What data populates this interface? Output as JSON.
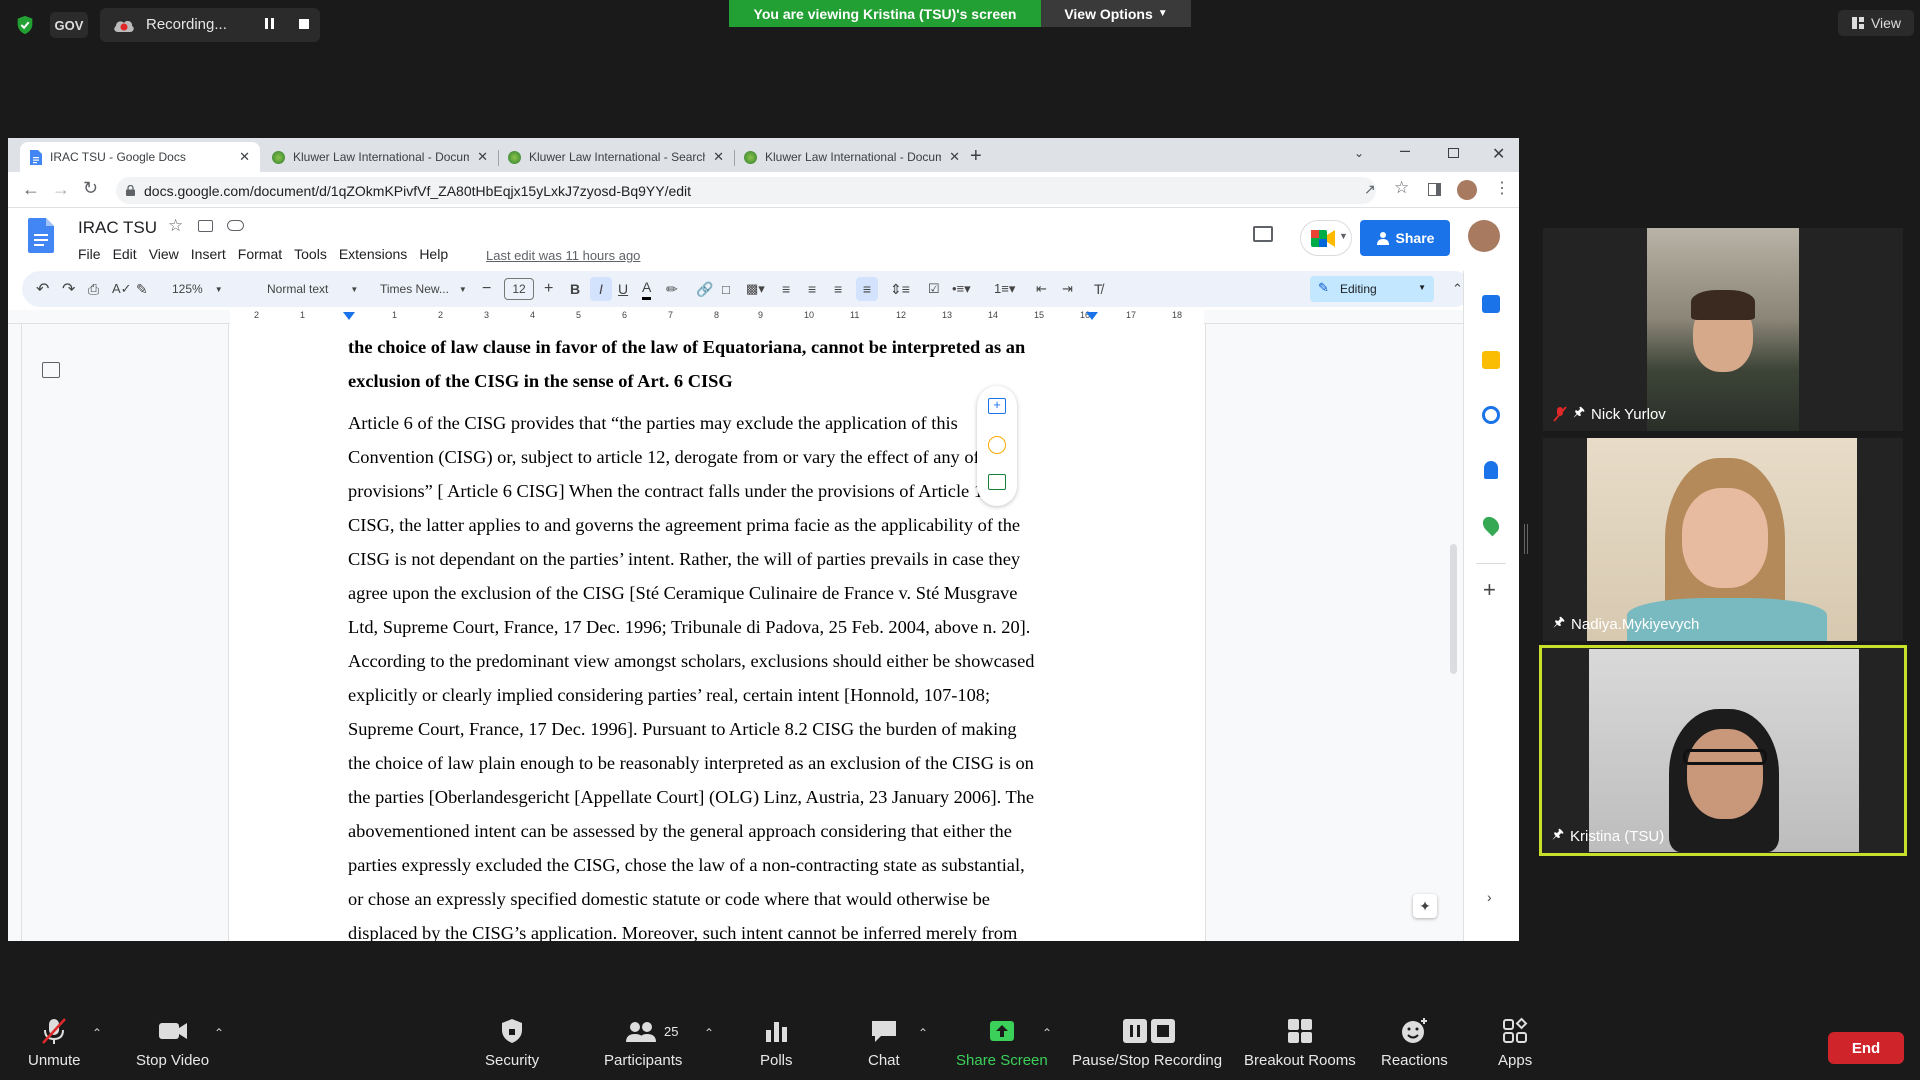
{
  "zoom": {
    "gov_label": "GOV",
    "recording_label": "Recording...",
    "viewing_banner": "You are viewing Kristina (TSU)'s screen",
    "view_options": "View Options",
    "view_label": "View",
    "bottom": {
      "unmute": "Unmute",
      "stop_video": "Stop Video",
      "security": "Security",
      "participants": "Participants",
      "participants_count": "25",
      "polls": "Polls",
      "chat": "Chat",
      "share_screen": "Share Screen",
      "pause_stop_recording": "Pause/Stop Recording",
      "breakout_rooms": "Breakout Rooms",
      "reactions": "Reactions",
      "apps": "Apps",
      "end": "End"
    },
    "participants": [
      {
        "name": "Nick Yurlov"
      },
      {
        "name": "Nadiya.Mykiyevych"
      },
      {
        "name": "Kristina (TSU)"
      }
    ]
  },
  "browser": {
    "tabs": [
      {
        "title": "IRAC TSU - Google Docs"
      },
      {
        "title": "Kluwer Law International - Docum"
      },
      {
        "title": "Kluwer Law International - Search"
      },
      {
        "title": "Kluwer Law International - Docum"
      }
    ],
    "url": "docs.google.com/document/d/1qZOkmKPivfVf_ZA80tHbEqjx15yLxkJ7zyosd-Bq9YY/edit"
  },
  "docs": {
    "title": "IRAC TSU",
    "menu": [
      "File",
      "Edit",
      "View",
      "Insert",
      "Format",
      "Tools",
      "Extensions",
      "Help"
    ],
    "last_edit": "Last edit was 11 hours ago",
    "share": "Share",
    "toolbar": {
      "zoom": "125%",
      "style": "Normal text",
      "font": "Times New...",
      "font_size": "12",
      "mode": "Editing"
    },
    "ruler_numbers": [
      "2",
      "1",
      "1",
      "2",
      "3",
      "4",
      "5",
      "6",
      "7",
      "8",
      "9",
      "10",
      "11",
      "12",
      "13",
      "14",
      "15",
      "16",
      "17",
      "18"
    ],
    "heading_lines": [
      "the choice of law clause in favor of the law of Equatoriana, cannot be interpreted as an",
      "exclusion of the CISG in the sense of Art. 6 CISG"
    ],
    "body_lines": [
      "Article 6 of the CISG provides that “the parties may exclude the application of this",
      "Convention (CISG) or, subject to article 12, derogate from or vary the effect of any of its",
      "provisions” [ Article 6 CISG] When the contract falls under the provisions of Article 1.1",
      "CISG, the latter applies to and governs the agreement prima facie as the applicability of the",
      "CISG is not dependant on the parties’ intent. Rather, the will of parties prevails in case they",
      "agree upon the exclusion of the CISG [Sté Ceramique Culinaire de France v. Sté Musgrave",
      "Ltd, Supreme Court, France, 17 Dec. 1996; Tribunale di Padova, 25 Feb. 2004, above n. 20].",
      "According to the predominant view amongst scholars, exclusions should either be showcased",
      "explicitly or clearly implied considering parties’ real, certain intent [Honnold, 107-108;",
      "Supreme Court, France, 17 Dec. 1996]. Pursuant to Article 8.2 CISG the burden of making",
      "the choice of law plain enough to be reasonably interpreted as an exclusion of the CISG is on",
      "the parties [Oberlandesgericht [Appellate Court] (OLG) Linz, Austria, 23 January 2006]. The",
      "abovementioned intent can be assessed by the general approach considering that either the",
      "parties expressly excluded the CISG, chose the law of a non-contracting state as substantial,",
      "or chose an expressly specified domestic statute or code where that would otherwise be",
      "displaced by the CISG’s application. Moreover, such intent cannot be inferred merely from"
    ]
  },
  "colors": {
    "zoom_green": "#23a033",
    "share_blue": "#1a73e8",
    "end_red": "#d0242b",
    "active_speaker": "#c9e02a"
  }
}
